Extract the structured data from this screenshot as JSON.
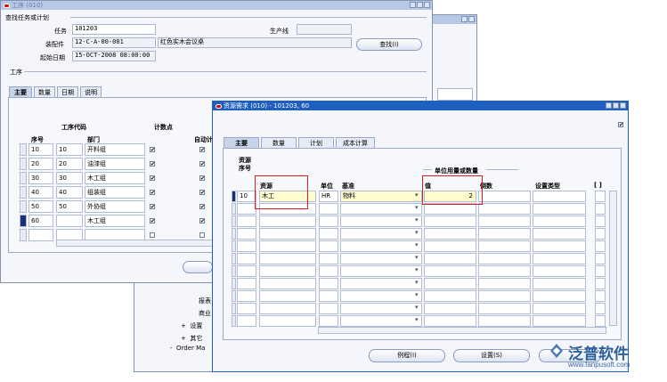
{
  "background_window": {
    "menu_items": [
      "报表",
      "商业",
      "设置",
      "其它"
    ],
    "order_text": "Order Ma"
  },
  "work_order_window": {
    "title": "工序 (010)",
    "section_find": "查找任务或计划",
    "task_label": "任务",
    "task_value": "101203",
    "production_line_label": "生产线",
    "production_line_value": "",
    "assembly_label": "装配件",
    "assembly_value": "12-C-A-00-001",
    "assembly_desc": "红色实木会议桌",
    "start_date_label": "起始日期",
    "start_date_value": "15-OCT-2008 08:00:00",
    "find_button": "查找(I)",
    "section_ops": "工序",
    "tabs": [
      "主要",
      "数量",
      "日期",
      "说明"
    ],
    "col_code": "工序代码",
    "col_count_point": "计数点",
    "col_seq": "序号",
    "col_dept": "部门",
    "col_auto": "自动计",
    "rows": [
      {
        "seq": "10",
        "code": "10",
        "dept": "开料组",
        "count": "✔",
        "auto": "✔"
      },
      {
        "seq": "20",
        "code": "20",
        "dept": "油漆组",
        "count": "✔",
        "auto": "✔"
      },
      {
        "seq": "30",
        "code": "30",
        "dept": "木工组",
        "count": "✔",
        "auto": "✔"
      },
      {
        "seq": "40",
        "code": "40",
        "dept": "组装组",
        "count": "✔",
        "auto": "✔"
      },
      {
        "seq": "50",
        "code": "50",
        "dept": "外协组",
        "count": "✔",
        "auto": "✔"
      },
      {
        "seq": "60",
        "code": "",
        "dept": "木工组",
        "count": "✔",
        "auto": "✔"
      },
      {
        "seq": "",
        "code": "",
        "dept": "",
        "count": "",
        "auto": ""
      }
    ]
  },
  "resource_window": {
    "title": "资源需求 (010) - 101203, 60",
    "tabs": [
      "主要",
      "数量",
      "计划",
      "成本计算"
    ],
    "col_resource_seq_1": "资源",
    "col_resource_seq_2": "序号",
    "col_resource": "资源",
    "col_unit": "单位",
    "col_basis": "基准",
    "group_usage": "单位用量或数量",
    "col_value": "值",
    "col_inverse": "倒数",
    "col_setup_type": "设置类型",
    "col_bracket": "[ ]",
    "row": {
      "seq": "10",
      "resource": "木工",
      "unit": "HR",
      "basis": "物料",
      "value": "2",
      "inverse": "",
      "setup_type": ""
    },
    "btn_routine": "例程(I)",
    "btn_settings": "设置(S)"
  },
  "watermark": {
    "brand": "泛普软件",
    "url": "www.fanpusoft.com"
  }
}
